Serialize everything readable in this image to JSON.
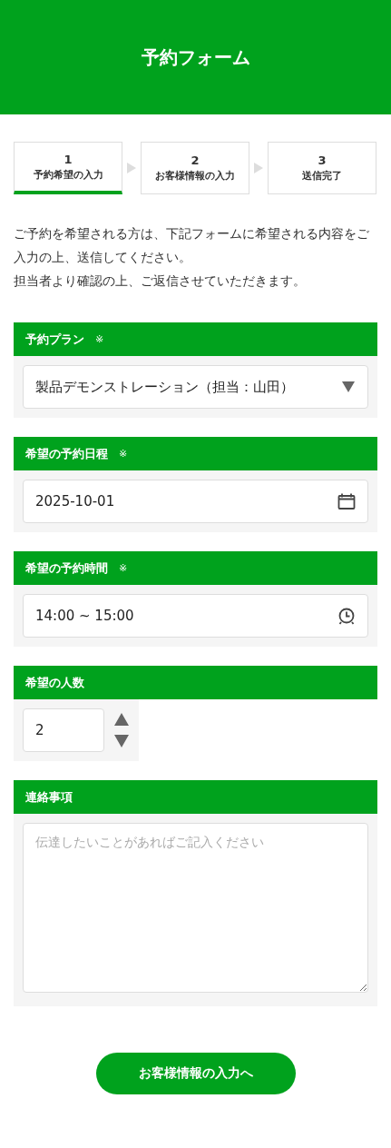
{
  "header": {
    "title": "予約フォーム"
  },
  "steps": [
    {
      "number": "1",
      "label": "予約希望の入力",
      "selected": true
    },
    {
      "number": "2",
      "label": "お客様情報の入力",
      "selected": false
    },
    {
      "number": "3",
      "label": "送信完了",
      "selected": false
    }
  ],
  "intro": [
    "ご予約を希望される方は、下記フォームに希望される内容をご入力の上、送信してください。",
    "担当者より確認の上、ご返信させていただきます。"
  ],
  "sections": [
    {
      "label": "予約プラン",
      "mark": "※",
      "kind": "select",
      "value": "製品デモンストレーション（担当：山田）"
    },
    {
      "label": "希望の予約日程",
      "mark": "※",
      "kind": "date",
      "value": "2025-10-01"
    },
    {
      "label": "希望の予約時間",
      "mark": "※",
      "kind": "time",
      "value": "14:00 ~ 15:00"
    },
    {
      "label": "希望の人数",
      "kind": "number",
      "value": "2"
    },
    {
      "label": "連絡事項",
      "kind": "textarea",
      "placeholder": "伝達したいことがあればご記入ください"
    }
  ],
  "submit_button": "お客様情報の入力へ"
}
